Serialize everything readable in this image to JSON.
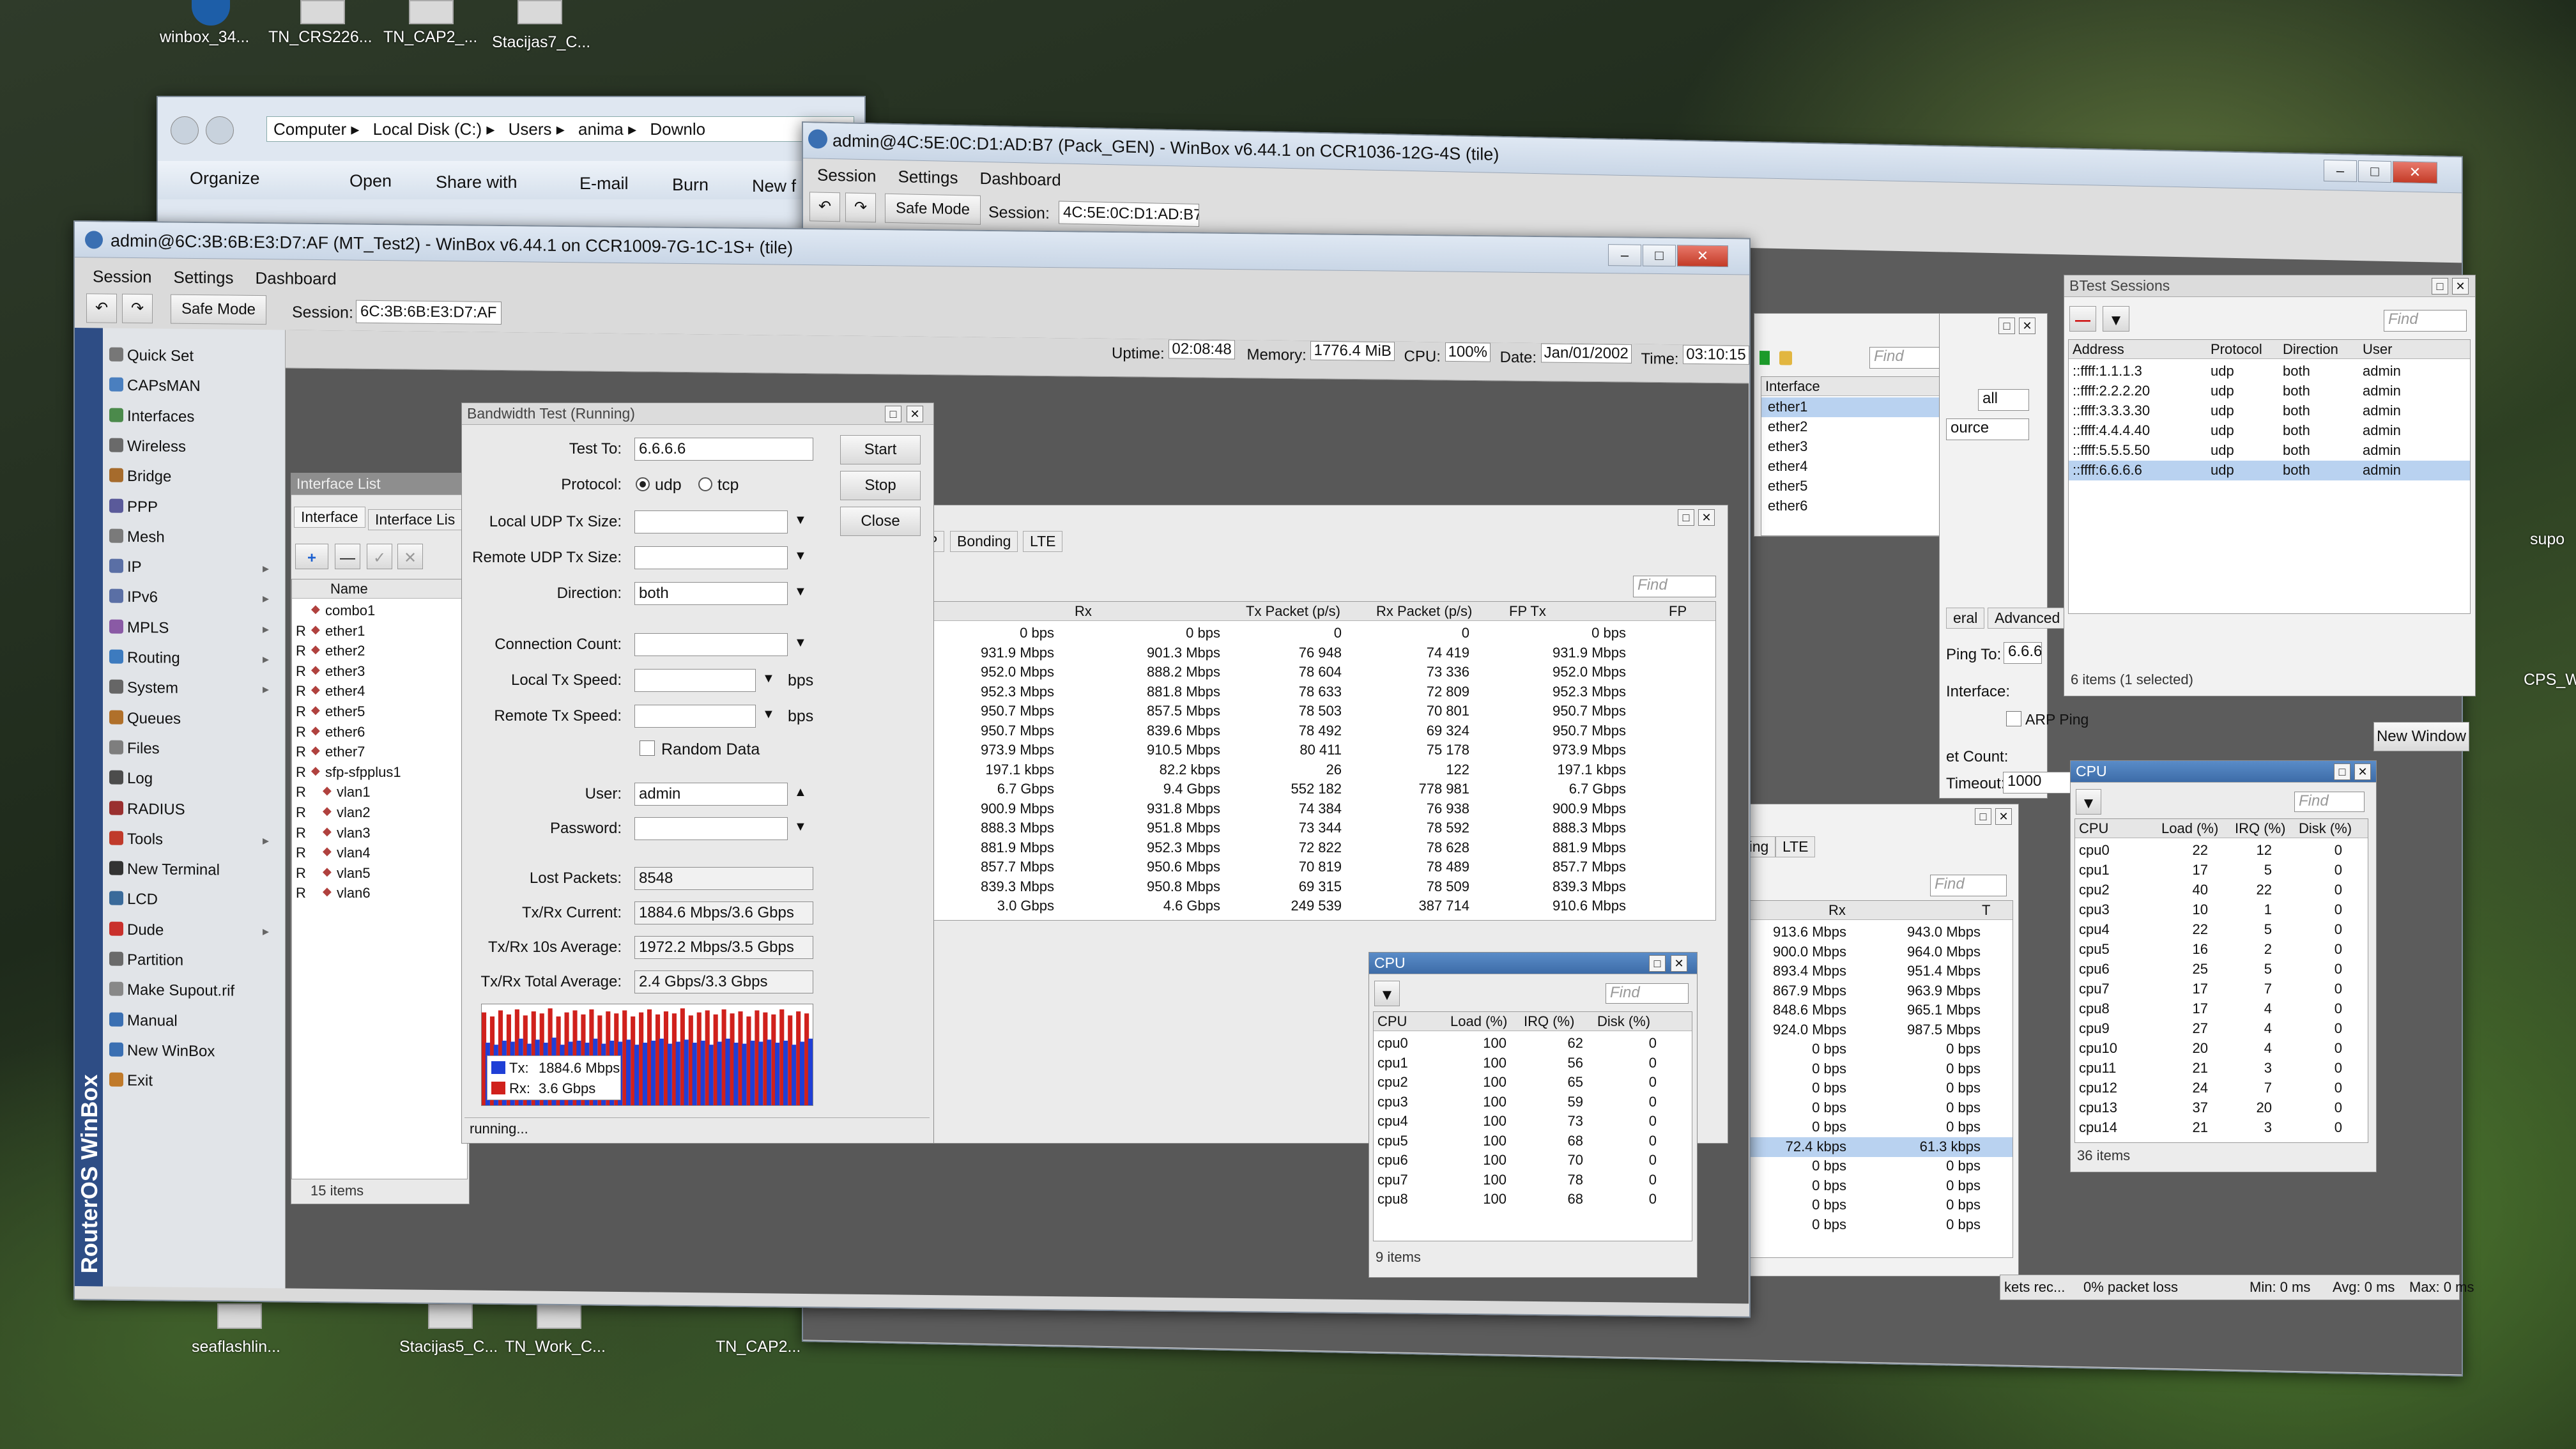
{
  "desktop": {
    "icons": [
      "winbox_34...",
      "TN_CRS226...",
      "TN_CAP2_...",
      "Stacijas7_C..."
    ],
    "bottom_icons": [
      "seaflashlin...",
      "Stacijas5_C...",
      "TN_Work_C...",
      "TN_CAP2..."
    ],
    "right_labels": [
      "supo",
      "CPS_W"
    ]
  },
  "explorer": {
    "nav": [
      "Computer",
      "Local Disk (C:)",
      "Users",
      "anima",
      "Downlo"
    ],
    "toolbar": [
      "Organize",
      "Open",
      "Share with",
      "E-mail",
      "Burn",
      "New f"
    ]
  },
  "win2": {
    "title": "admin@4C:5E:0C:D1:AD:B7 (Pack_GEN) - WinBox v6.44.1 on CCR1036-12G-4S (tile)",
    "menu": [
      "Session",
      "Settings",
      "Dashboard"
    ],
    "safe_mode": "Safe Mode",
    "session_label": "Session:",
    "session_value": "4C:5E:0C:D1:AD:B7"
  },
  "win1": {
    "title": "admin@6C:3B:6B:E3:D7:AF (MT_Test2) - WinBox v6.44.1 on CCR1009-7G-1C-1S+ (tile)",
    "menu": [
      "Session",
      "Settings",
      "Dashboard"
    ],
    "safe_mode": "Safe Mode",
    "session_label": "Session:",
    "session_value": "6C:3B:6B:E3:D7:AF",
    "status": {
      "uptime_label": "Uptime:",
      "uptime": "02:08:48",
      "memory_label": "Memory:",
      "memory": "1776.4 MiB",
      "cpu_label": "CPU:",
      "cpu": "100%",
      "date_label": "Date:",
      "date": "Jan/01/2002",
      "time_label": "Time:",
      "time": "03:10:15"
    },
    "sidebar_brand": "RouterOS WinBox",
    "sidebar": [
      "Quick Set",
      "CAPsMAN",
      "Interfaces",
      "Wireless",
      "Bridge",
      "PPP",
      "Mesh",
      "IP",
      "IPv6",
      "MPLS",
      "Routing",
      "System",
      "Queues",
      "Files",
      "Log",
      "RADIUS",
      "Tools",
      "New Terminal",
      "LCD",
      "Dude",
      "Partition",
      "Make Supout.rif",
      "Manual",
      "New WinBox",
      "Exit"
    ]
  },
  "iflist": {
    "title": "Interface List",
    "tabs": [
      "Interface",
      "Interface Lis"
    ],
    "col_name": "Name",
    "count": "15 items",
    "rows": [
      {
        "f": "",
        "n": "combo1"
      },
      {
        "f": "R",
        "n": "ether1"
      },
      {
        "f": "R",
        "n": "ether2"
      },
      {
        "f": "R",
        "n": "ether3"
      },
      {
        "f": "R",
        "n": "ether4"
      },
      {
        "f": "R",
        "n": "ether5"
      },
      {
        "f": "R",
        "n": "ether6"
      },
      {
        "f": "R",
        "n": "ether7"
      },
      {
        "f": "R",
        "n": "sfp-sfpplus1"
      },
      {
        "f": "R",
        "n": "vlan1"
      },
      {
        "f": "R",
        "n": "vlan2"
      },
      {
        "f": "R",
        "n": "vlan3"
      },
      {
        "f": "R",
        "n": "vlan4"
      },
      {
        "f": "R",
        "n": "vlan5"
      },
      {
        "f": "R",
        "n": "vlan6"
      }
    ]
  },
  "traffic": {
    "tabs": [
      "P",
      "Bonding",
      "LTE"
    ],
    "find": "Find",
    "cols": [
      "Rx",
      "Tx Packet (p/s)",
      "Rx Packet (p/s)",
      "FP Tx",
      "FP"
    ],
    "rows": [
      [
        "0 bps",
        "0 bps",
        "0",
        "0",
        "0 bps"
      ],
      [
        "931.9 Mbps",
        "901.3 Mbps",
        "76 948",
        "74 419",
        "931.9 Mbps"
      ],
      [
        "952.0 Mbps",
        "888.2 Mbps",
        "78 604",
        "73 336",
        "952.0 Mbps"
      ],
      [
        "952.3 Mbps",
        "881.8 Mbps",
        "78 633",
        "72 809",
        "952.3 Mbps"
      ],
      [
        "950.7 Mbps",
        "857.5 Mbps",
        "78 503",
        "70 801",
        "950.7 Mbps"
      ],
      [
        "950.7 Mbps",
        "839.6 Mbps",
        "78 492",
        "69 324",
        "950.7 Mbps"
      ],
      [
        "973.9 Mbps",
        "910.5 Mbps",
        "80 411",
        "75 178",
        "973.9 Mbps"
      ],
      [
        "197.1 kbps",
        "82.2 kbps",
        "26",
        "122",
        "197.1 kbps"
      ],
      [
        "6.7 Gbps",
        "9.4 Gbps",
        "552 182",
        "778 981",
        "6.7 Gbps"
      ],
      [
        "900.9 Mbps",
        "931.8 Mbps",
        "74 384",
        "76 938",
        "900.9 Mbps"
      ],
      [
        "888.3 Mbps",
        "951.8 Mbps",
        "73 344",
        "78 592",
        "888.3 Mbps"
      ],
      [
        "881.9 Mbps",
        "952.3 Mbps",
        "72 822",
        "78 628",
        "881.9 Mbps"
      ],
      [
        "857.7 Mbps",
        "950.6 Mbps",
        "70 819",
        "78 489",
        "857.7 Mbps"
      ],
      [
        "839.3 Mbps",
        "950.8 Mbps",
        "69 315",
        "78 509",
        "839.3 Mbps"
      ],
      [
        "3.0 Gbps",
        "4.6 Gbps",
        "249 539",
        "387 714",
        "910.6 Mbps"
      ]
    ]
  },
  "bwtest": {
    "title": "Bandwidth Test (Running)",
    "buttons": [
      "Start",
      "Stop",
      "Close"
    ],
    "test_to_label": "Test To:",
    "test_to": "6.6.6.6",
    "protocol_label": "Protocol:",
    "udp": "udp",
    "tcp": "tcp",
    "local_udp_label": "Local UDP Tx Size:",
    "remote_udp_label": "Remote UDP Tx Size:",
    "direction_label": "Direction:",
    "direction": "both",
    "conn_label": "Connection Count:",
    "local_speed_label": "Local Tx Speed:",
    "remote_speed_label": "Remote Tx Speed:",
    "bps": "bps",
    "random": "Random Data",
    "user_label": "User:",
    "user": "admin",
    "password_label": "Password:",
    "lost_label": "Lost Packets:",
    "lost": "8548",
    "cur_label": "Tx/Rx Current:",
    "cur": "1884.6 Mbps/3.6 Gbps",
    "avg10_label": "Tx/Rx 10s Average:",
    "avg10": "1972.2 Mbps/3.5 Gbps",
    "tot_label": "Tx/Rx Total Average:",
    "tot": "2.4 Gbps/3.3 Gbps",
    "legend_tx": "Tx:",
    "legend_tx_val": "1884.6 Mbps",
    "legend_rx": "Rx:",
    "legend_rx_val": "3.6 Gbps",
    "status": "running...",
    "tx_color": "#1f3fd6",
    "rx_color": "#d0211c",
    "graph_tx": [
      0.62,
      0.6,
      0.64,
      0.63,
      0.66,
      0.61,
      0.65,
      0.62,
      0.67,
      0.6,
      0.63,
      0.64,
      0.62,
      0.66,
      0.61,
      0.64,
      0.63,
      0.65,
      0.6,
      0.62,
      0.64,
      0.66,
      0.61,
      0.63,
      0.65,
      0.62,
      0.64,
      0.6,
      0.63,
      0.66,
      0.62,
      0.61,
      0.64,
      0.63,
      0.65,
      0.62,
      0.64,
      0.6,
      0.63,
      0.66
    ],
    "graph_rx": [
      0.92,
      0.88,
      0.94,
      0.9,
      0.95,
      0.89,
      0.93,
      0.91,
      0.96,
      0.88,
      0.92,
      0.94,
      0.9,
      0.95,
      0.89,
      0.93,
      0.91,
      0.94,
      0.88,
      0.92,
      0.95,
      0.9,
      0.93,
      0.91,
      0.96,
      0.89,
      0.92,
      0.94,
      0.9,
      0.95,
      0.91,
      0.93,
      0.88,
      0.94,
      0.92,
      0.9,
      0.95,
      0.89,
      0.93,
      0.91
    ]
  },
  "cpu1": {
    "title": "CPU",
    "find": "Find",
    "cols": [
      "CPU",
      "Load (%)",
      "IRQ (%)",
      "Disk (%)"
    ],
    "count": "9 items",
    "rows": [
      [
        "cpu0",
        "100",
        "62",
        "0"
      ],
      [
        "cpu1",
        "100",
        "56",
        "0"
      ],
      [
        "cpu2",
        "100",
        "65",
        "0"
      ],
      [
        "cpu3",
        "100",
        "59",
        "0"
      ],
      [
        "cpu4",
        "100",
        "73",
        "0"
      ],
      [
        "cpu5",
        "100",
        "68",
        "0"
      ],
      [
        "cpu6",
        "100",
        "70",
        "0"
      ],
      [
        "cpu7",
        "100",
        "78",
        "0"
      ],
      [
        "cpu8",
        "100",
        "68",
        "0"
      ]
    ]
  },
  "w2iface": {
    "find": "Find",
    "col": "Interface",
    "rows": [
      "ether1",
      "ether2",
      "ether3",
      "ether4",
      "ether5",
      "ether6"
    ],
    "filter": "all",
    "source": "ource"
  },
  "w2traffic": {
    "tabs": [
      "nding",
      "LTE"
    ],
    "find": "Find",
    "col_rx": "Rx",
    "col_t": "T",
    "rows": [
      [
        "913.6 Mbps",
        "943.0 Mbps"
      ],
      [
        "900.0 Mbps",
        "964.0 Mbps"
      ],
      [
        "893.4 Mbps",
        "951.4 Mbps"
      ],
      [
        "867.9 Mbps",
        "963.9 Mbps"
      ],
      [
        "848.6 Mbps",
        "965.1 Mbps"
      ],
      [
        "924.0 Mbps",
        "987.5 Mbps"
      ],
      [
        "0 bps",
        "0 bps"
      ],
      [
        "0 bps",
        "0 bps"
      ],
      [
        "0 bps",
        "0 bps"
      ],
      [
        "0 bps",
        "0 bps"
      ],
      [
        "0 bps",
        "0 bps"
      ],
      [
        "72.4 kbps",
        "61.3 kbps"
      ],
      [
        "0 bps",
        "0 bps"
      ],
      [
        "0 bps",
        "0 bps"
      ],
      [
        "0 bps",
        "0 bps"
      ],
      [
        "0 bps",
        "0 bps"
      ]
    ]
  },
  "w2ping": {
    "tabs": [
      "eral",
      "Advanced"
    ],
    "ping_to_label": "Ping To:",
    "ping_to": "6.6.6",
    "interface_label": "Interface:",
    "arp": "ARP Ping",
    "count_label": "et Count:",
    "timeout_label": "Timeout:",
    "timeout": "1000",
    "new_window": "New Window",
    "stats": [
      "kets rec...",
      "0% packet loss",
      "Min: 0 ms",
      "Avg: 0 ms",
      "Max: 0 ms"
    ]
  },
  "btsessions": {
    "title": "BTest Sessions",
    "find": "Find",
    "cols": [
      "Address",
      "Protocol",
      "Direction",
      "User"
    ],
    "count": "6 items (1 selected)",
    "rows": [
      [
        "::ffff:1.1.1.3",
        "udp",
        "both",
        "admin"
      ],
      [
        "::ffff:2.2.2.20",
        "udp",
        "both",
        "admin"
      ],
      [
        "::ffff:3.3.3.30",
        "udp",
        "both",
        "admin"
      ],
      [
        "::ffff:4.4.4.40",
        "udp",
        "both",
        "admin"
      ],
      [
        "::ffff:5.5.5.50",
        "udp",
        "both",
        "admin"
      ],
      [
        "::ffff:6.6.6.6",
        "udp",
        "both",
        "admin"
      ]
    ]
  },
  "cpu2": {
    "title": "CPU",
    "find": "Find",
    "cols": [
      "CPU",
      "Load (%)",
      "IRQ (%)",
      "Disk (%)"
    ],
    "count": "36 items",
    "rows": [
      [
        "cpu0",
        "22",
        "12",
        "0"
      ],
      [
        "cpu1",
        "17",
        "5",
        "0"
      ],
      [
        "cpu2",
        "40",
        "22",
        "0"
      ],
      [
        "cpu3",
        "10",
        "1",
        "0"
      ],
      [
        "cpu4",
        "22",
        "5",
        "0"
      ],
      [
        "cpu5",
        "16",
        "2",
        "0"
      ],
      [
        "cpu6",
        "25",
        "5",
        "0"
      ],
      [
        "cpu7",
        "17",
        "7",
        "0"
      ],
      [
        "cpu8",
        "17",
        "4",
        "0"
      ],
      [
        "cpu9",
        "27",
        "4",
        "0"
      ],
      [
        "cpu10",
        "20",
        "4",
        "0"
      ],
      [
        "cpu11",
        "21",
        "3",
        "0"
      ],
      [
        "cpu12",
        "24",
        "7",
        "0"
      ],
      [
        "cpu13",
        "37",
        "20",
        "0"
      ],
      [
        "cpu14",
        "21",
        "3",
        "0"
      ]
    ]
  }
}
